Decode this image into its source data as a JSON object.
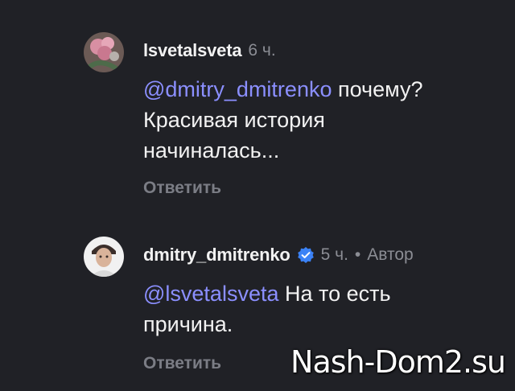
{
  "comments": [
    {
      "username": "lsvetalsveta",
      "time": "6 ч.",
      "mention": "@dmitry_dmitrenko",
      "line1_rest": " почему?",
      "line2": "Красивая история",
      "line3": "начиналась...",
      "reply_label": "Ответить",
      "avatar_icon": "flowers-avatar"
    },
    {
      "username": "dmitry_dmitrenko",
      "verified_icon": "verified-badge-icon",
      "time": "5 ч.",
      "dot": "•",
      "author_label": "Автор",
      "mention": "@lsvetalsveta",
      "line1_rest": " На то есть",
      "line2": "причина.",
      "reply_label": "Ответить",
      "avatar_icon": "man-portrait-avatar"
    }
  ],
  "watermark": "Nash-Dom2.su",
  "colors": {
    "background": "#202126",
    "mention": "#8b8fff",
    "muted": "#8b8d94",
    "verified": "#3b82f6"
  }
}
